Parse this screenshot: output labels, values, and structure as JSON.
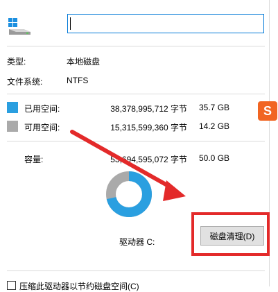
{
  "drive": {
    "name_value": "",
    "type_label": "类型:",
    "type_value": "本地磁盘",
    "fs_label": "文件系统:",
    "fs_value": "NTFS"
  },
  "usage": {
    "used": {
      "label": "已用空间:",
      "bytes": "38,378,995,712 字节",
      "size": "35.7 GB",
      "color": "#2a9fe0",
      "fraction": 0.714
    },
    "free": {
      "label": "可用空间:",
      "bytes": "15,315,599,360 字节",
      "size": "14.2 GB",
      "color": "#aaaaaa",
      "fraction": 0.286
    },
    "capacity": {
      "label": "容量:",
      "bytes": "53,694,595,072 字节",
      "size": "50.0 GB"
    }
  },
  "drive_label": "驱动器 C:",
  "cleanup_button": {
    "label": "磁盘清理(D)"
  },
  "footer_checkbox_label": "压缩此驱动器以节约磁盘空间(C)",
  "annotation": {
    "arrow_color": "#e32a2a",
    "box_color": "#e32a2a"
  },
  "icons": {
    "drive": "drive-icon",
    "logo": "sogou-logo-icon"
  }
}
